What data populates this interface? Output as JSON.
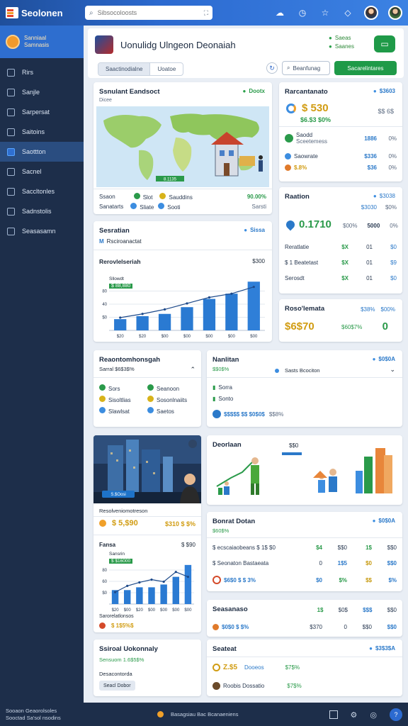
{
  "app": {
    "name": "Seolonen"
  },
  "search": {
    "placeholder": "Sibsocoloosts"
  },
  "sidebar": {
    "header": [
      "Sanniaal",
      "Samnasis"
    ],
    "items": [
      {
        "label": "Rirs"
      },
      {
        "label": "Sanjle"
      },
      {
        "label": "Sarpersat"
      },
      {
        "label": "Saitoins"
      },
      {
        "label": "Saottton"
      },
      {
        "label": "Sacnel"
      },
      {
        "label": "Saccltonles"
      },
      {
        "label": "Sadnstolis"
      },
      {
        "label": "Seasasamn"
      }
    ]
  },
  "header": {
    "title": "Uonulidg Ulngeon Deonaiah",
    "status": [
      "Saeas",
      "Saanes"
    ],
    "seg": [
      "Saactinodialne",
      "Uoatoe"
    ],
    "search_label": "Beanfunag",
    "action_label": "Sacarelintares"
  },
  "map_card": {
    "title": "Ssnulant Eandsoct",
    "subtitle": "Dicee",
    "pill": "Dootx",
    "map_tag": "8.1135",
    "legend_rows": [
      {
        "a": "Ssaon",
        "b": "Slot",
        "c": "Sauddins",
        "d": "90.00%"
      },
      {
        "a": "Sanatarts",
        "b": "Sliate",
        "c": "Sooti",
        "d": "Sarsti"
      }
    ]
  },
  "bar_card1": {
    "title": "Sesratian",
    "subtitle": "Rsciroanactat",
    "pill": "Sissa",
    "chart_title": "Rerovlelseriah",
    "chart_value": "$300",
    "legend": [
      "Sllowdt",
      "$ 88,880"
    ]
  },
  "chart_data": [
    {
      "type": "bar",
      "categories": [
        "$20",
        "$20",
        "$00",
        "$00",
        "$00",
        "$00",
        "$00"
      ],
      "values": [
        30,
        38,
        44,
        62,
        84,
        98,
        130
      ],
      "line": [
        34,
        44,
        56,
        72,
        88,
        98,
        116
      ],
      "ylim": [
        0,
        140
      ],
      "ylabels": [
        "80",
        "40",
        "$0"
      ],
      "title": "Rerovlelseriah"
    },
    {
      "type": "bar",
      "categories": [
        "$20",
        "$00",
        "$20",
        "$00",
        "$00",
        "$00",
        "$00"
      ],
      "values": [
        40,
        40,
        48,
        48,
        56,
        78,
        112
      ],
      "line": [
        34,
        52,
        62,
        70,
        64,
        92,
        78
      ],
      "ylim": [
        0,
        130
      ],
      "ylabels": [
        "80",
        "60",
        "$0"
      ],
      "title": "Fansa"
    }
  ],
  "right1": {
    "title": "Rarcantanato",
    "pill": "$3603",
    "big": "$ 530",
    "sub": "$6.$3 $0%",
    "tag": "$$ 6$",
    "rows": [
      {
        "label": "Saodd",
        "sub": "Sceetemess",
        "a": "1886",
        "b": "0%"
      },
      {
        "label": "Saowrate",
        "a": "$336",
        "b": "0%"
      },
      {
        "label": "$.8%",
        "a": "$36",
        "b": "0%"
      }
    ]
  },
  "right2": {
    "title": "Raation",
    "pill": "$3038",
    "sub": [
      "$3030",
      "$0%"
    ],
    "big": "0.1710",
    "mid": "$00%",
    "mid2": "5000",
    "mid3": "0%",
    "rows": [
      {
        "label": "Reratlatie",
        "a": "$X",
        "b": "01",
        "c": "$0"
      },
      {
        "label": "$ 1 Beatetast",
        "a": "$X",
        "b": "01",
        "c": "$9"
      },
      {
        "label": "Serosdt",
        "a": "$X",
        "b": "01",
        "c": "$0"
      }
    ]
  },
  "right3": {
    "title": "Roso'lemata",
    "pill1": "$38%",
    "pill2": "$00%",
    "big": "$6$70",
    "mid": "$60$7%",
    "big2": "0"
  },
  "perf_card": {
    "title": "Reaontomhonsgah",
    "sub": "Sarral $6$3$%",
    "rows": [
      {
        "a": "Sors",
        "b": "Seanoon"
      },
      {
        "a": "Sisoltlias",
        "b": "Sosonlnaiits"
      },
      {
        "a": "Slawlsat",
        "b": "Saetos"
      }
    ]
  },
  "region_card": {
    "title": "Nanlitan",
    "sub": "$$0$%",
    "pill": "$0$0A",
    "filter": "Sasts Bcociton",
    "rows": [
      "Sorra",
      "Sonto"
    ],
    "foot": "$$$$$ $$ $0$0$",
    "foot2": "$$8%"
  },
  "city_card": {
    "tag": "S.$Oosi",
    "caption": "Resolveniomotreson",
    "left_val": "$ 5,$90",
    "right_val": "$310 $ $%",
    "chart_title": "Fansa",
    "chart_value": "$ $90",
    "legend": [
      "Sansrin",
      "$ $16000"
    ],
    "foot": [
      "Sarorelatlonsos",
      "$ 1$5%$"
    ]
  },
  "illus_card": {
    "title": "Deorlaan",
    "value": "$$0"
  },
  "table_card": {
    "title": "Bonrat Dotan",
    "sub": "$60$%",
    "pill": "$0$0A",
    "rows": [
      {
        "label": "$ ecscaiaobeans $ 1$ $0",
        "a": "$4",
        "b": "$$0",
        "c": "1$",
        "d": "$$0"
      },
      {
        "label": "$ Seonaton Bastaeata",
        "a": "0",
        "b": "1$5",
        "c": "$0",
        "d": "$$0"
      },
      {
        "label": "$6$0 $ $ 3%",
        "a": "$0",
        "b": "$%",
        "c": "$$",
        "d": "$%"
      }
    ]
  },
  "small_card": {
    "title": "Seasanaso",
    "a": "1$",
    "b": "$0$",
    "c": "$$$",
    "d": "$$0",
    "row": {
      "label": "$0$0 $ $%",
      "a": "$370",
      "b": "0",
      "c": "$$0",
      "d": "$$0"
    }
  },
  "social_card": {
    "title": "Ssiroal Uokonnaly",
    "sub": "Sensuom 1.6$5$%",
    "detail": "Desacontorda",
    "button": "Seacl Dobor"
  },
  "final_card": {
    "title": "Seateat",
    "pill": "$3$3$A",
    "rows": [
      {
        "label": "Z.$5",
        "b": "Dooeos",
        "c": "$7$%"
      },
      {
        "label": "Roobis Dossatio",
        "c": "$7$%"
      }
    ]
  },
  "bottom": {
    "left": [
      "Sooaon Geaorolsoles",
      "Sooctad Sa'sol nsodins"
    ],
    "center": "Basagsiau Bac Bcanaeniens"
  },
  "colors": {
    "accent": "#2c6ad0",
    "green": "#1f9a48",
    "sidebar": "#1d2e4a"
  }
}
